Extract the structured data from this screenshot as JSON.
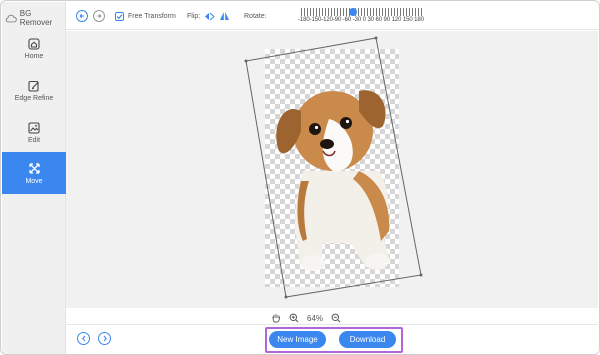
{
  "app": {
    "title": "BG Remover"
  },
  "sidebar": {
    "items": [
      {
        "label": "Home",
        "icon": "home-icon"
      },
      {
        "label": "Edge Refine",
        "icon": "edit-pencil-icon"
      },
      {
        "label": "Edit",
        "icon": "image-edit-icon"
      },
      {
        "label": "Move",
        "icon": "move-arrows-icon",
        "active": true
      }
    ]
  },
  "toolbar": {
    "free_transform_label": "Free Transform",
    "free_transform_checked": true,
    "flip_label": "Flip:",
    "rotate_label": "Rotate:",
    "rotate_scale": "-180-150-120-90 -60 -30 0 30 60 90 120 150 180",
    "rotate_value": -30
  },
  "canvas": {
    "zoom_level": "64%"
  },
  "footer": {
    "new_image_label": "New Image",
    "download_label": "Download"
  },
  "colors": {
    "accent": "#3a87f0",
    "highlight": "#b266d8",
    "sidebar_bg": "#f0f0f0",
    "canvas_bg": "#f1f1f1"
  }
}
